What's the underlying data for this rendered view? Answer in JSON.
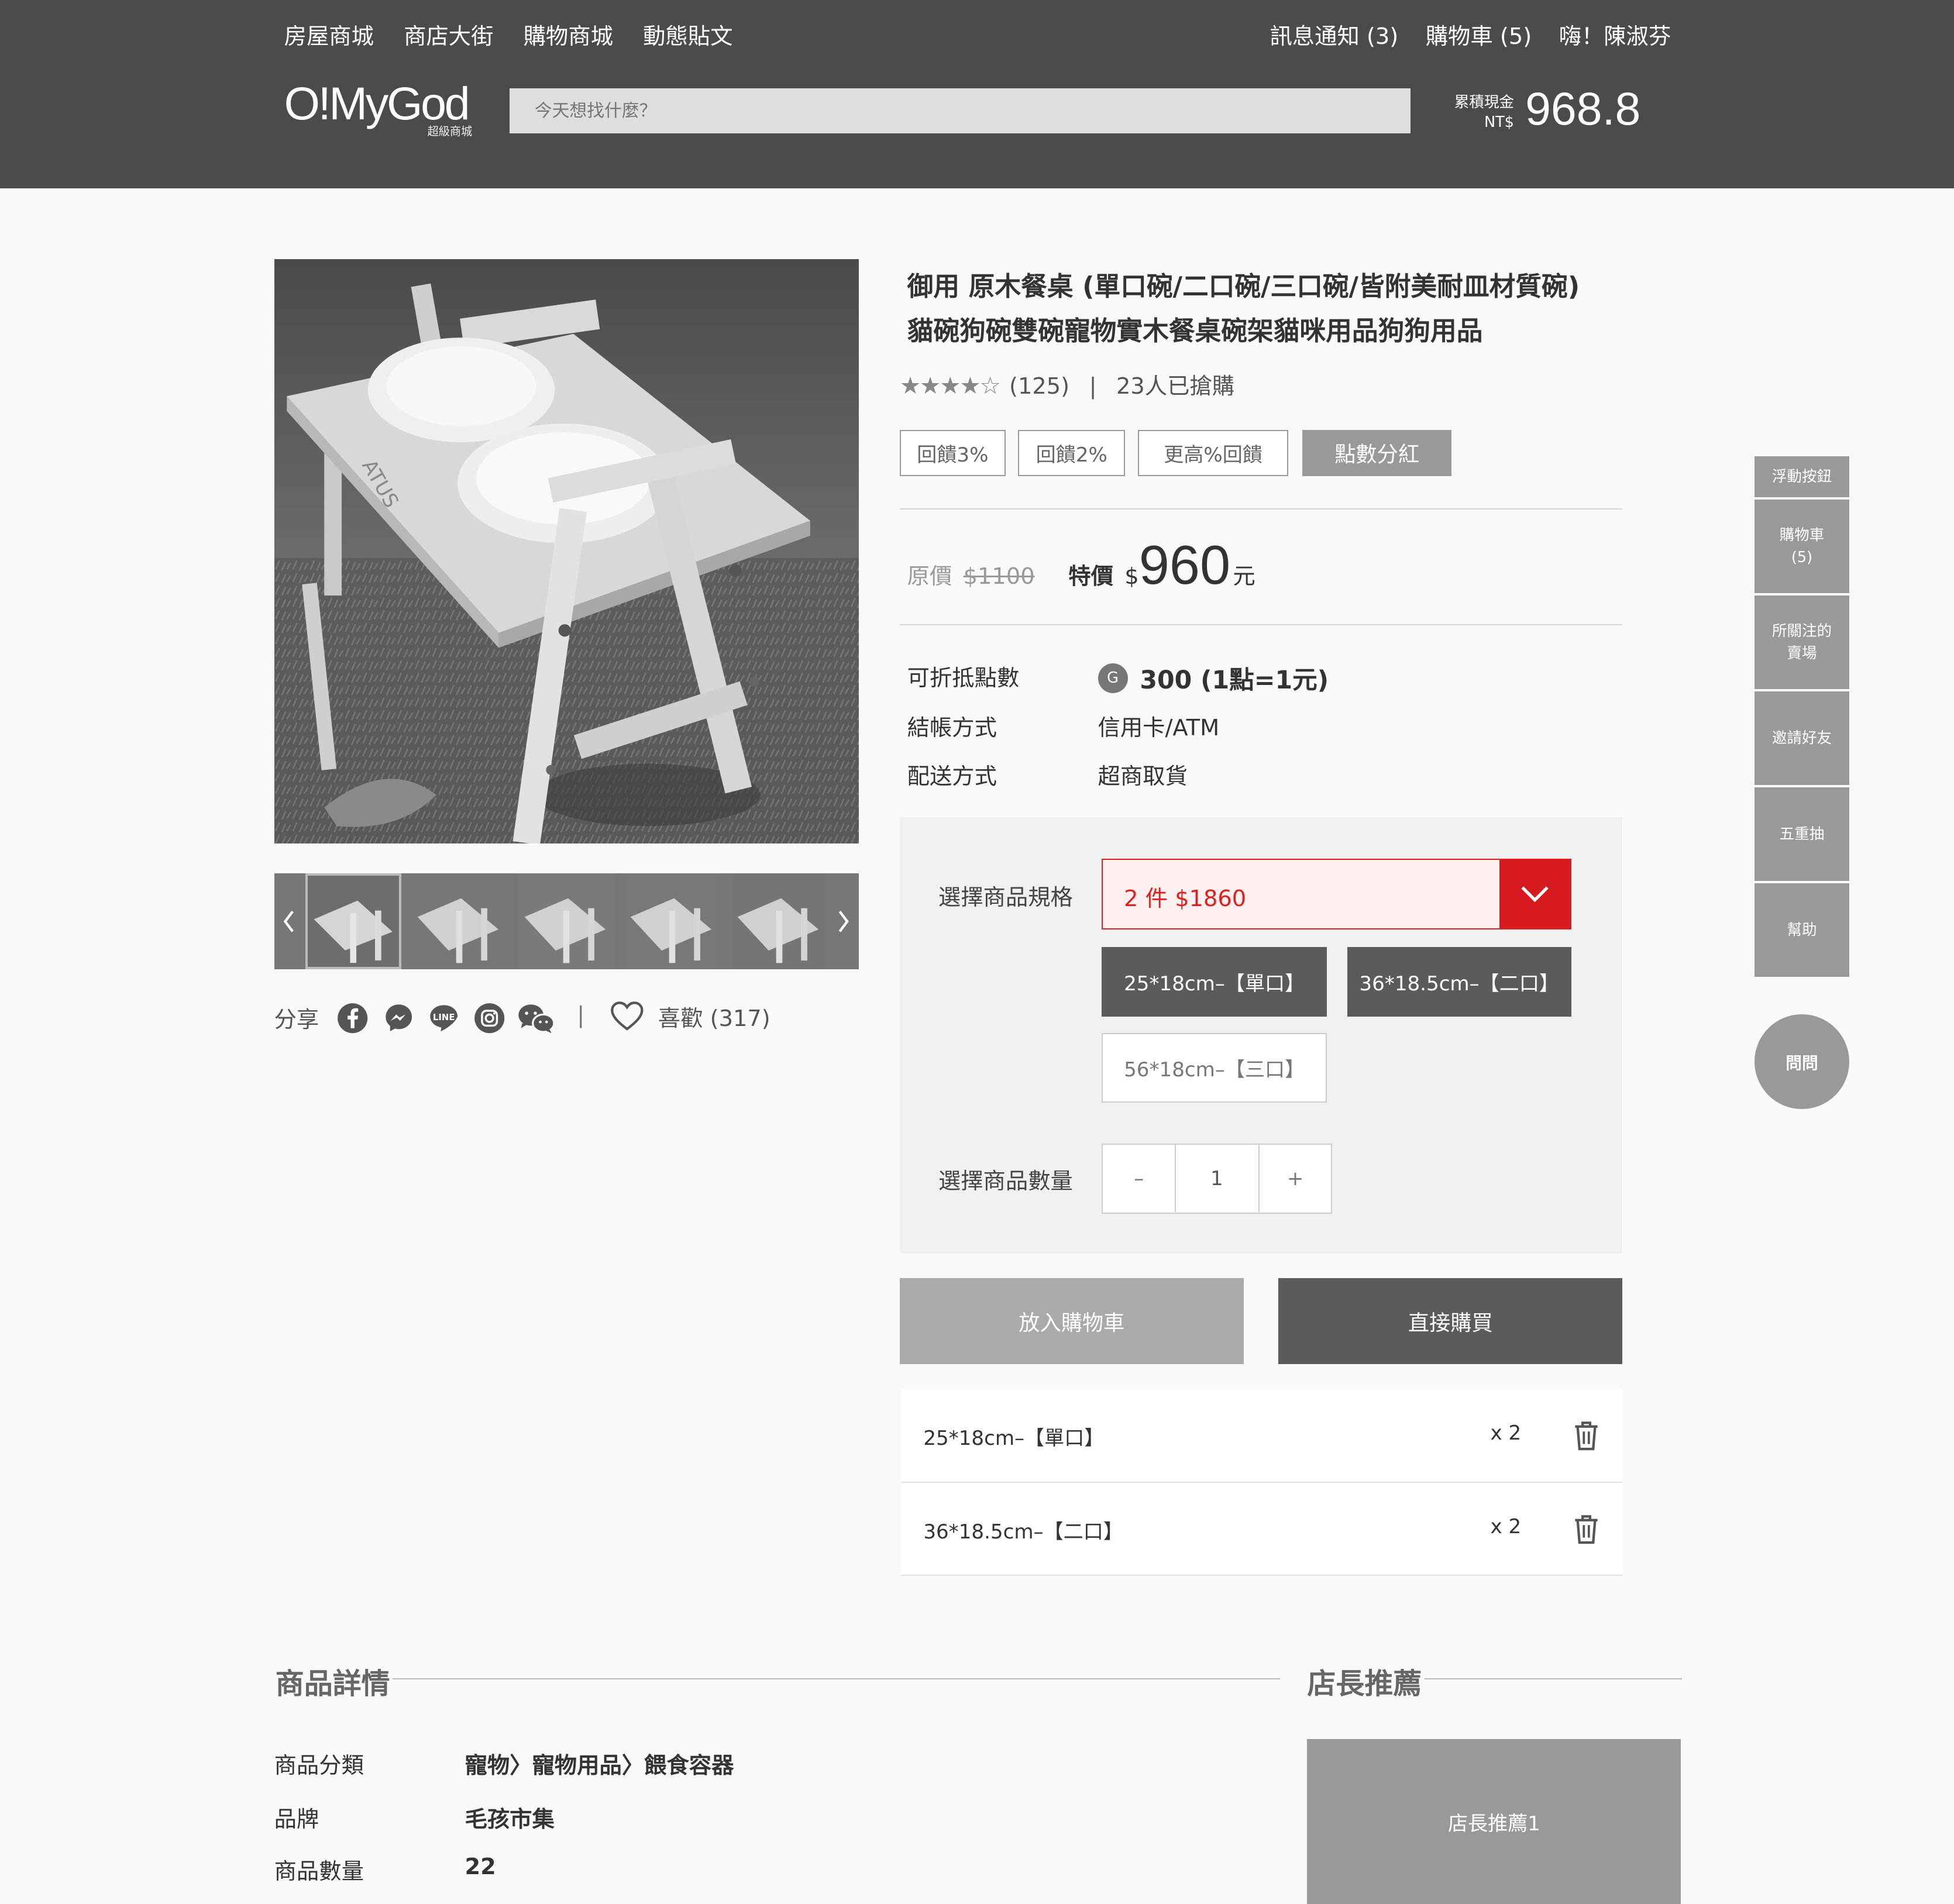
{
  "header": {
    "nav": [
      "房屋商城",
      "商店大街",
      "購物商城",
      "動態貼文"
    ],
    "notifications": "訊息通知 (3)",
    "cart": "購物車 (5)",
    "greeting": "嗨！陳淑芬",
    "logo": "O!MyGod",
    "logo_sub": "超級商城",
    "search_placeholder": "今天想找什麼？",
    "cash_label_1": "累積現金",
    "cash_label_2": "NT$",
    "cash_value": "968.8"
  },
  "product": {
    "title_line1": "御用 原木餐桌 (單口碗/二口碗/三口碗/皆附美耐皿材質碗)",
    "title_line2": "貓碗狗碗雙碗寵物實木餐桌碗架貓咪用品狗狗用品",
    "stars": "★★★★☆",
    "rating_value": 4,
    "review_count": "(125)",
    "separator": "|",
    "purchased": "23人已搶購",
    "tags": [
      "回饋3%",
      "回饋2%",
      "更高%回饋",
      "點數分紅"
    ],
    "original_label": "原價",
    "original_price": "$1100",
    "special_label": "特價",
    "currency": "$",
    "special_price": "960",
    "unit": "元",
    "info": [
      {
        "label": "可折抵點數",
        "value": "300 (1點=1元)",
        "badge": "G"
      },
      {
        "label": "結帳方式",
        "value": "信用卡/ATM"
      },
      {
        "label": "配送方式",
        "value": "超商取貨"
      }
    ]
  },
  "gallery": {
    "share_label": "分享",
    "share_icons": [
      "facebook-icon",
      "messenger-icon",
      "line-icon",
      "instagram-icon",
      "wechat-icon"
    ],
    "like_count": "喜歡 (317)",
    "line_text": "LINE",
    "divider": "|"
  },
  "spec": {
    "label": "選擇商品規格",
    "selected": "2 件 $1860",
    "options": [
      {
        "label": "25*18cm–【單口】",
        "selected": true
      },
      {
        "label": "36*18.5cm–【二口】",
        "selected": true
      },
      {
        "label": "56*18cm–【三口】",
        "selected": false
      }
    ],
    "qty_label": "選擇商品數量",
    "qty_minus": "–",
    "qty_value": "1",
    "qty_plus": "+"
  },
  "actions": {
    "add_cart": "放入購物車",
    "buy_now": "直接購買"
  },
  "cart_items": [
    {
      "name": "25*18cm–【單口】",
      "qty": "x 2"
    },
    {
      "name": "36*18.5cm–【二口】",
      "qty": "x 2"
    }
  ],
  "sidebar": {
    "items": [
      "浮動按鈕",
      "購物車\n(5)",
      "所關注的\n賣場",
      "邀請好友",
      "五重抽",
      "幫助"
    ],
    "ask": "問問"
  },
  "details": {
    "title": "商品詳情",
    "rows": [
      {
        "label": "商品分類",
        "value": "寵物〉寵物用品〉餵食容器"
      },
      {
        "label": "品牌",
        "value": "毛孩市集"
      },
      {
        "label": "商品數量",
        "value": "22"
      }
    ]
  },
  "recommend": {
    "title": "店長推薦",
    "card": "店長推薦1"
  },
  "colors": {
    "header_bg": "#4b4b4b",
    "accent_red": "#d71920",
    "gray_button": "#aaaaaa",
    "dark_button": "#5b5b5b"
  }
}
